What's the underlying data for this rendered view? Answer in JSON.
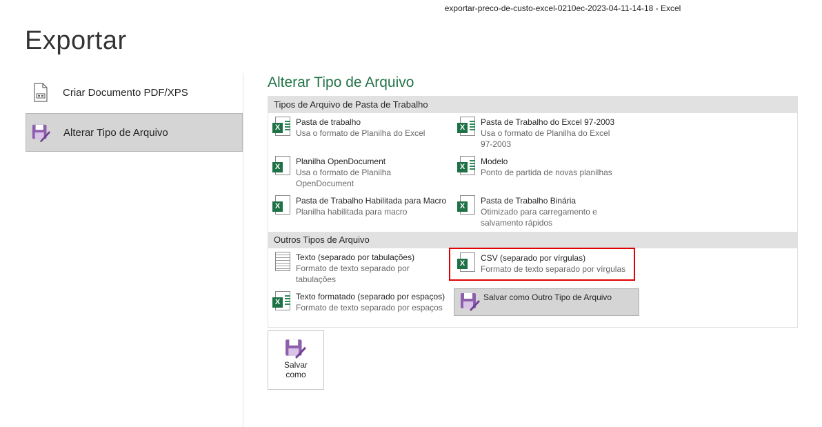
{
  "window": {
    "title": "exportar-preco-de-custo-excel-0210ec-2023-04-11-14-18  -  Excel"
  },
  "page": {
    "title": "Exportar"
  },
  "nav": {
    "items": [
      {
        "label": "Criar Documento PDF/XPS"
      },
      {
        "label": "Alterar Tipo de Arquivo"
      }
    ]
  },
  "main": {
    "title": "Alterar Tipo de Arquivo",
    "workbook_group": {
      "header": "Tipos de Arquivo de Pasta de Trabalho",
      "options": [
        {
          "label": "Pasta de trabalho",
          "desc": "Usa o formato de Planilha do Excel"
        },
        {
          "label": "Pasta de Trabalho do Excel 97-2003",
          "desc": "Usa o formato de Planilha do Excel 97-2003"
        },
        {
          "label": "Planilha OpenDocument",
          "desc": "Usa o formato de Planilha OpenDocument"
        },
        {
          "label": "Modelo",
          "desc": "Ponto de partida de novas planilhas"
        },
        {
          "label": "Pasta de Trabalho Habilitada para Macro",
          "desc": "Planilha habilitada para macro"
        },
        {
          "label": "Pasta de Trabalho Binária",
          "desc": "Otimizado para carregamento e salvamento rápidos"
        }
      ]
    },
    "other_group": {
      "header": "Outros Tipos de Arquivo",
      "options": [
        {
          "label": "Texto (separado por tabulações)",
          "desc": "Formato de texto separado por tabulações"
        },
        {
          "label": "CSV (separado por vírgulas)",
          "desc": "Formato de texto separado por vírgulas"
        },
        {
          "label": "Texto formatado (separado por espaços)",
          "desc": "Formato de texto separado por espaços"
        },
        {
          "label": "Salvar como Outro Tipo de Arquivo"
        }
      ]
    },
    "save_button": {
      "line1": "Salvar",
      "line2": "como"
    }
  },
  "colors": {
    "accent": "#217346",
    "highlight_border": "#e00000",
    "selected_bg": "#d5d5d5",
    "save_icon": "#8e5fad"
  },
  "icons": [
    "pdf-document-icon",
    "save-as-icon",
    "excel-workbook-icon",
    "excel-97-icon",
    "opendocument-icon",
    "template-icon",
    "macro-workbook-icon",
    "binary-workbook-icon",
    "text-file-icon",
    "csv-icon",
    "formatted-text-icon",
    "save-as-other-icon"
  ]
}
